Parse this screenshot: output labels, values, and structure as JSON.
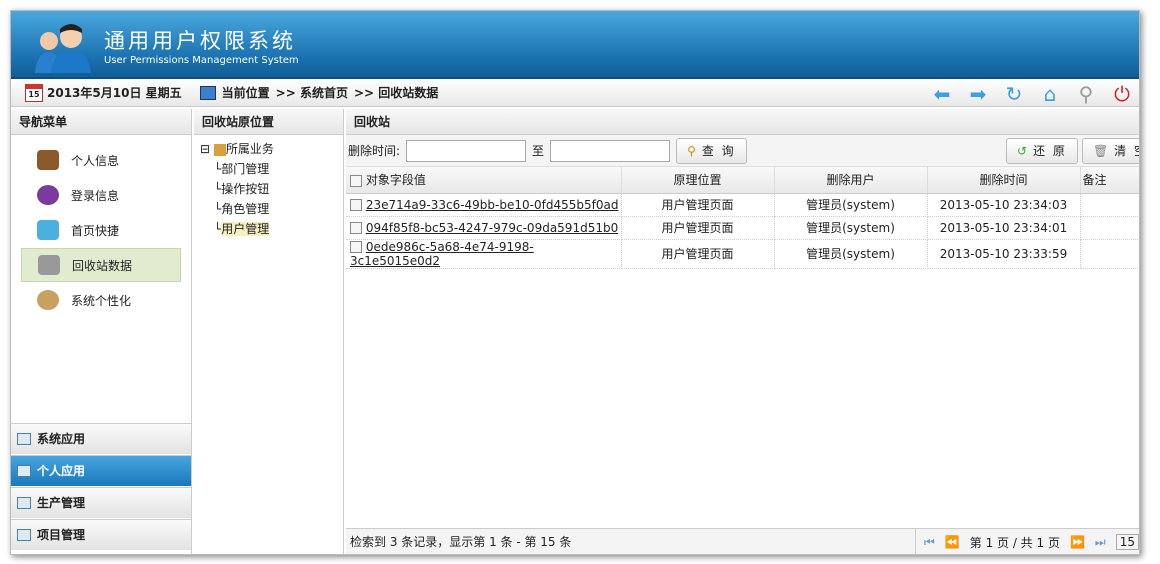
{
  "header": {
    "title": "通用用户权限系统",
    "subtitle": "User Permissions Management System"
  },
  "crumb": {
    "date": "2013年5月10日 星期五",
    "location_label": "当前位置",
    "path": [
      ">> 系统首页",
      ">> 回收站数据"
    ],
    "cal_day": "15"
  },
  "nav": {
    "title": "导航菜单",
    "items": [
      {
        "label": "个人信息"
      },
      {
        "label": "登录信息"
      },
      {
        "label": "首页快捷"
      },
      {
        "label": "回收站数据"
      },
      {
        "label": "系统个性化"
      }
    ],
    "sections": [
      {
        "label": "系统应用"
      },
      {
        "label": "个人应用"
      },
      {
        "label": "生产管理"
      },
      {
        "label": "项目管理"
      }
    ]
  },
  "tree": {
    "title": "回收站原位置",
    "root": "所属业务",
    "children": [
      "部门管理",
      "操作按钮",
      "角色管理",
      "用户管理"
    ]
  },
  "main": {
    "title": "回收站",
    "filter_label": "删除时间:",
    "to_label": "至",
    "query": "查 询",
    "restore": "还 原",
    "clear": "清 空",
    "columns": [
      "对象字段值",
      "原理位置",
      "删除用户",
      "删除时间",
      "备注"
    ],
    "rows": [
      {
        "value": "23e714a9-33c6-49bb-be10-0fd455b5f0ad",
        "location": "用户管理页面",
        "user": "管理员(system)",
        "time": "2013-05-10 23:34:03",
        "note": ""
      },
      {
        "value": "094f85f8-bc53-4247-979c-09da591d51b0",
        "location": "用户管理页面",
        "user": "管理员(system)",
        "time": "2013-05-10 23:34:01",
        "note": ""
      },
      {
        "value": "0ede986c-5a68-4e74-9198-3c1e5015e0d2",
        "location": "用户管理页面",
        "user": "管理员(system)",
        "time": "2013-05-10 23:33:59",
        "note": ""
      }
    ],
    "pager": {
      "summary": "检索到 3 条记录，显示第 1 条 - 第 15 条",
      "page": "第 1 页 / 共 1 页",
      "size": "15"
    }
  }
}
